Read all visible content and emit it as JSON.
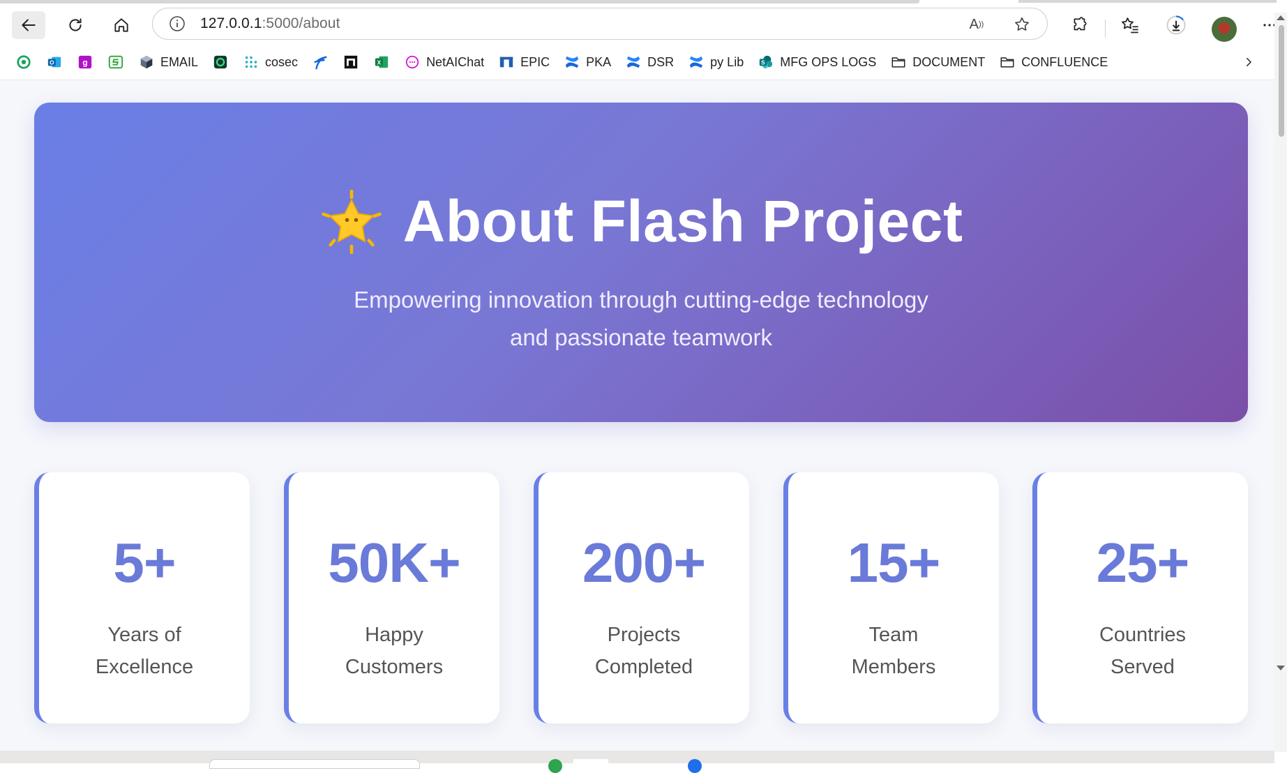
{
  "browser": {
    "url_host": "127.0.0.1",
    "url_rest": ":5000/about",
    "read_aloud_label": "A",
    "bookmarks": [
      {
        "label": "",
        "icon": "green-ring-icon"
      },
      {
        "label": "",
        "icon": "outlook-icon"
      },
      {
        "label": "",
        "icon": "g-tile-icon"
      },
      {
        "label": "",
        "icon": "green-s-icon"
      },
      {
        "label": "EMAIL",
        "icon": "cube-icon"
      },
      {
        "label": "",
        "icon": "green-square-icon"
      },
      {
        "label": "cosec",
        "icon": "dots-grid-icon"
      },
      {
        "label": "",
        "icon": "blue-f-icon"
      },
      {
        "label": "",
        "icon": "black-n-icon"
      },
      {
        "label": "",
        "icon": "excel-icon"
      },
      {
        "label": "NetAIChat",
        "icon": "chat-bubble-icon"
      },
      {
        "label": "EPIC",
        "icon": "epic-icon"
      },
      {
        "label": "PKA",
        "icon": "confluence-icon"
      },
      {
        "label": "DSR",
        "icon": "confluence-icon"
      },
      {
        "label": "py Lib",
        "icon": "confluence-icon"
      },
      {
        "label": "MFG OPS LOGS",
        "icon": "sharepoint-icon"
      },
      {
        "label": "DOCUMENT",
        "icon": "folder-icon"
      },
      {
        "label": "CONFLUENCE",
        "icon": "folder-icon"
      }
    ]
  },
  "hero": {
    "title": "About Flash Project",
    "subtitle_line1": "Empowering innovation through cutting-edge technology",
    "subtitle_line2": "and passionate teamwork",
    "icon": "glowing-star-icon"
  },
  "stats": [
    {
      "value": "5+",
      "label_line1": "Years of",
      "label_line2": "Excellence"
    },
    {
      "value": "50K+",
      "label_line1": "Happy",
      "label_line2": "Customers"
    },
    {
      "value": "200+",
      "label_line1": "Projects",
      "label_line2": "Completed"
    },
    {
      "value": "15+",
      "label_line1": "Team",
      "label_line2": "Members"
    },
    {
      "value": "25+",
      "label_line1": "Countries",
      "label_line2": "Served"
    }
  ],
  "colors": {
    "hero_gradient_start": "#6a7fe6",
    "hero_gradient_end": "#7b4fa8",
    "stat_accent": "#6a7ad8",
    "page_background": "#f5f7fb"
  }
}
